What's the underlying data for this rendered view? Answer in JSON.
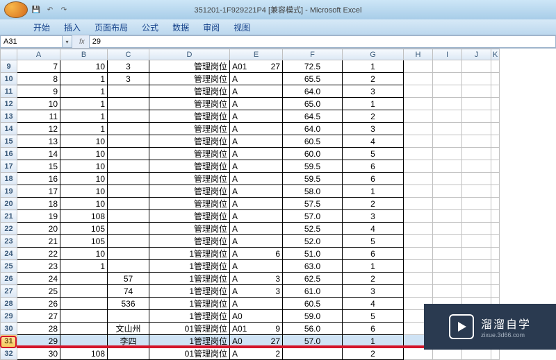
{
  "title": "351201-1F929221P4 [兼容模式] - Microsoft Excel",
  "menu": [
    "开始",
    "插入",
    "页面布局",
    "公式",
    "数据",
    "审阅",
    "视图"
  ],
  "nameBox": "A31",
  "fxLabel": "fx",
  "formula": "29",
  "columns": [
    "A",
    "B",
    "C",
    "D",
    "E",
    "F",
    "G",
    "H",
    "I",
    "J",
    "K"
  ],
  "selectedRowIdx": 31,
  "rows": [
    {
      "r": 9,
      "A": "7",
      "B": "10",
      "C": "3",
      "D": "管理岗位",
      "E": "A01",
      "E2": "27",
      "F": "72.5",
      "G": "1"
    },
    {
      "r": 10,
      "A": "8",
      "B": "1",
      "C": "3",
      "D": "管理岗位",
      "E": "A",
      "F": "65.5",
      "G": "2"
    },
    {
      "r": 11,
      "A": "9",
      "B": "1",
      "C": "",
      "D": "管理岗位",
      "E": "A",
      "F": "64.0",
      "G": "3"
    },
    {
      "r": 12,
      "A": "10",
      "B": "1",
      "C": "",
      "D": "管理岗位",
      "E": "A",
      "F": "65.0",
      "G": "1"
    },
    {
      "r": 13,
      "A": "11",
      "B": "1",
      "C": "",
      "D": "管理岗位",
      "E": "A",
      "F": "64.5",
      "G": "2"
    },
    {
      "r": 14,
      "A": "12",
      "B": "1",
      "C": "",
      "D": "管理岗位",
      "E": "A",
      "F": "64.0",
      "G": "3"
    },
    {
      "r": 15,
      "A": "13",
      "B": "10",
      "C": "",
      "D": "管理岗位",
      "E": "A",
      "F": "60.5",
      "G": "4"
    },
    {
      "r": 16,
      "A": "14",
      "B": "10",
      "C": "",
      "D": "管理岗位",
      "E": "A",
      "F": "60.0",
      "G": "5"
    },
    {
      "r": 17,
      "A": "15",
      "B": "10",
      "C": "",
      "D": "管理岗位",
      "E": "A",
      "F": "59.5",
      "G": "6"
    },
    {
      "r": 18,
      "A": "16",
      "B": "10",
      "C": "",
      "D": "管理岗位",
      "E": "A",
      "F": "59.5",
      "G": "6"
    },
    {
      "r": 19,
      "A": "17",
      "B": "10",
      "C": "",
      "D": "管理岗位",
      "E": "A",
      "F": "58.0",
      "G": "1"
    },
    {
      "r": 20,
      "A": "18",
      "B": "10",
      "C": "",
      "D": "管理岗位",
      "E": "A",
      "F": "57.5",
      "G": "2"
    },
    {
      "r": 21,
      "A": "19",
      "B": "108",
      "C": "",
      "D": "管理岗位",
      "E": "A",
      "F": "57.0",
      "G": "3"
    },
    {
      "r": 22,
      "A": "20",
      "B": "105",
      "C": "",
      "D": "管理岗位",
      "E": "A",
      "F": "52.5",
      "G": "4"
    },
    {
      "r": 23,
      "A": "21",
      "B": "105",
      "C": "",
      "D": "管理岗位",
      "E": "A",
      "F": "52.0",
      "G": "5"
    },
    {
      "r": 24,
      "A": "22",
      "B": "10",
      "C": "",
      "D": "1管理岗位",
      "E": "A",
      "E2": "6",
      "F": "51.0",
      "G": "6"
    },
    {
      "r": 25,
      "A": "23",
      "B": "1",
      "C": "",
      "D": "1管理岗位",
      "E": "A",
      "F": "63.0",
      "G": "1"
    },
    {
      "r": 26,
      "A": "24",
      "B": "",
      "C": "57",
      "D": "1管理岗位",
      "E": "A",
      "E2": "3",
      "F": "62.5",
      "G": "2"
    },
    {
      "r": 27,
      "A": "25",
      "B": "",
      "C": "74",
      "D": "1管理岗位",
      "E": "A",
      "E2": "3",
      "F": "61.0",
      "G": "3"
    },
    {
      "r": 28,
      "A": "26",
      "B": "",
      "C": "536",
      "D": "1管理岗位",
      "E": "A",
      "F": "60.5",
      "G": "4"
    },
    {
      "r": 29,
      "A": "27",
      "B": "",
      "C": "",
      "D": "1管理岗位",
      "E": "A0",
      "F": "59.0",
      "G": "5"
    },
    {
      "r": 30,
      "A": "28",
      "B": "",
      "C": "",
      "Cextra": "文山州",
      "D": "01管理岗位",
      "E": "A01",
      "E2": "9",
      "F": "56.0",
      "G": "6"
    },
    {
      "r": 31,
      "A": "29",
      "B": "",
      "C": "李四",
      "D": "1管理岗位",
      "E": "A0",
      "E2": "27",
      "F": "57.0",
      "G": "1",
      "selected": true
    },
    {
      "r": 32,
      "A": "30",
      "B": "108",
      "C": "",
      "D": "01管理岗位",
      "E": "A",
      "E2": "2",
      "F": "",
      "G": "2"
    }
  ],
  "watermark": {
    "brand": "溜溜自学",
    "url": "zixue.3d66.com"
  }
}
